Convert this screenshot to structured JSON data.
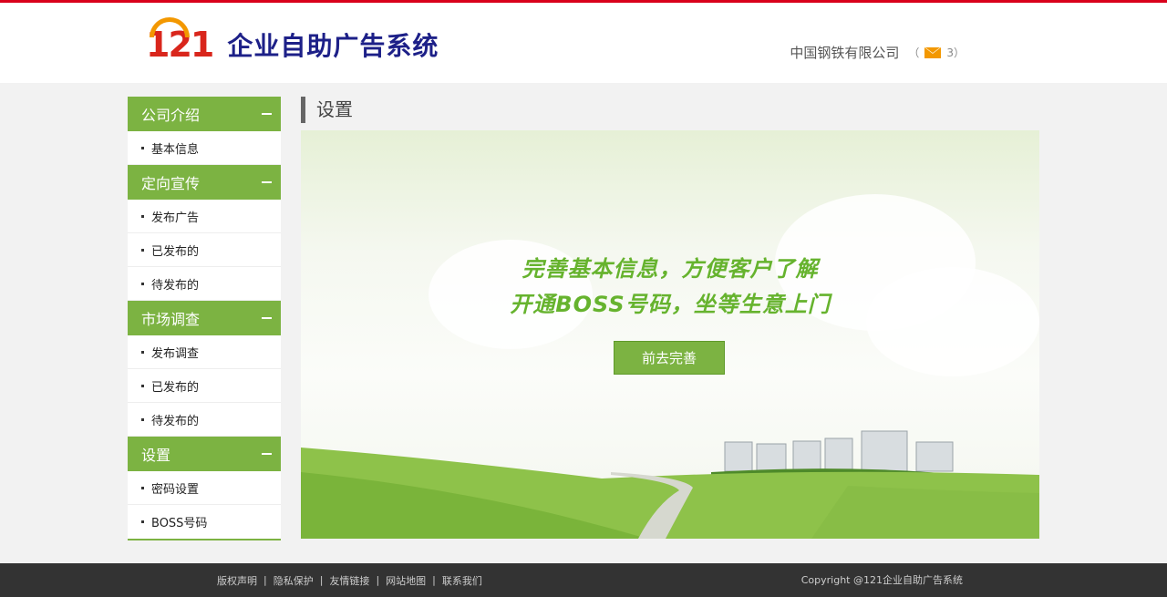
{
  "header": {
    "logo_number": "121",
    "logo_title": "企业自助广告系统",
    "company_name": "中国钢铁有限公司",
    "message_count_open": "（",
    "message_count": "3",
    "message_count_close": "）"
  },
  "sidebar": {
    "groups": [
      {
        "title": "公司介绍",
        "items": [
          "基本信息"
        ]
      },
      {
        "title": "定向宣传",
        "items": [
          "发布广告",
          "已发布的",
          "待发布的"
        ]
      },
      {
        "title": "市场调查",
        "items": [
          "发布调查",
          "已发布的",
          "待发布的"
        ]
      },
      {
        "title": "设置",
        "items": [
          "密码设置",
          "BOSS号码"
        ]
      }
    ]
  },
  "main": {
    "title": "设置",
    "banner": {
      "line1": "完善基本信息，方便客户了解",
      "line2": "开通BOSS号码，坐等生意上门",
      "button": "前去完善"
    }
  },
  "footer": {
    "links": [
      "版权声明",
      "隐私保护",
      "友情链接",
      "网站地图",
      "联系我们"
    ],
    "separator": "|",
    "copyright": "Copyright @121企业自助广告系统"
  },
  "colors": {
    "accent_green": "#7cb342",
    "top_bar_red": "#d9001b",
    "logo_blue": "#1d2088",
    "footer_bg": "#333333"
  }
}
